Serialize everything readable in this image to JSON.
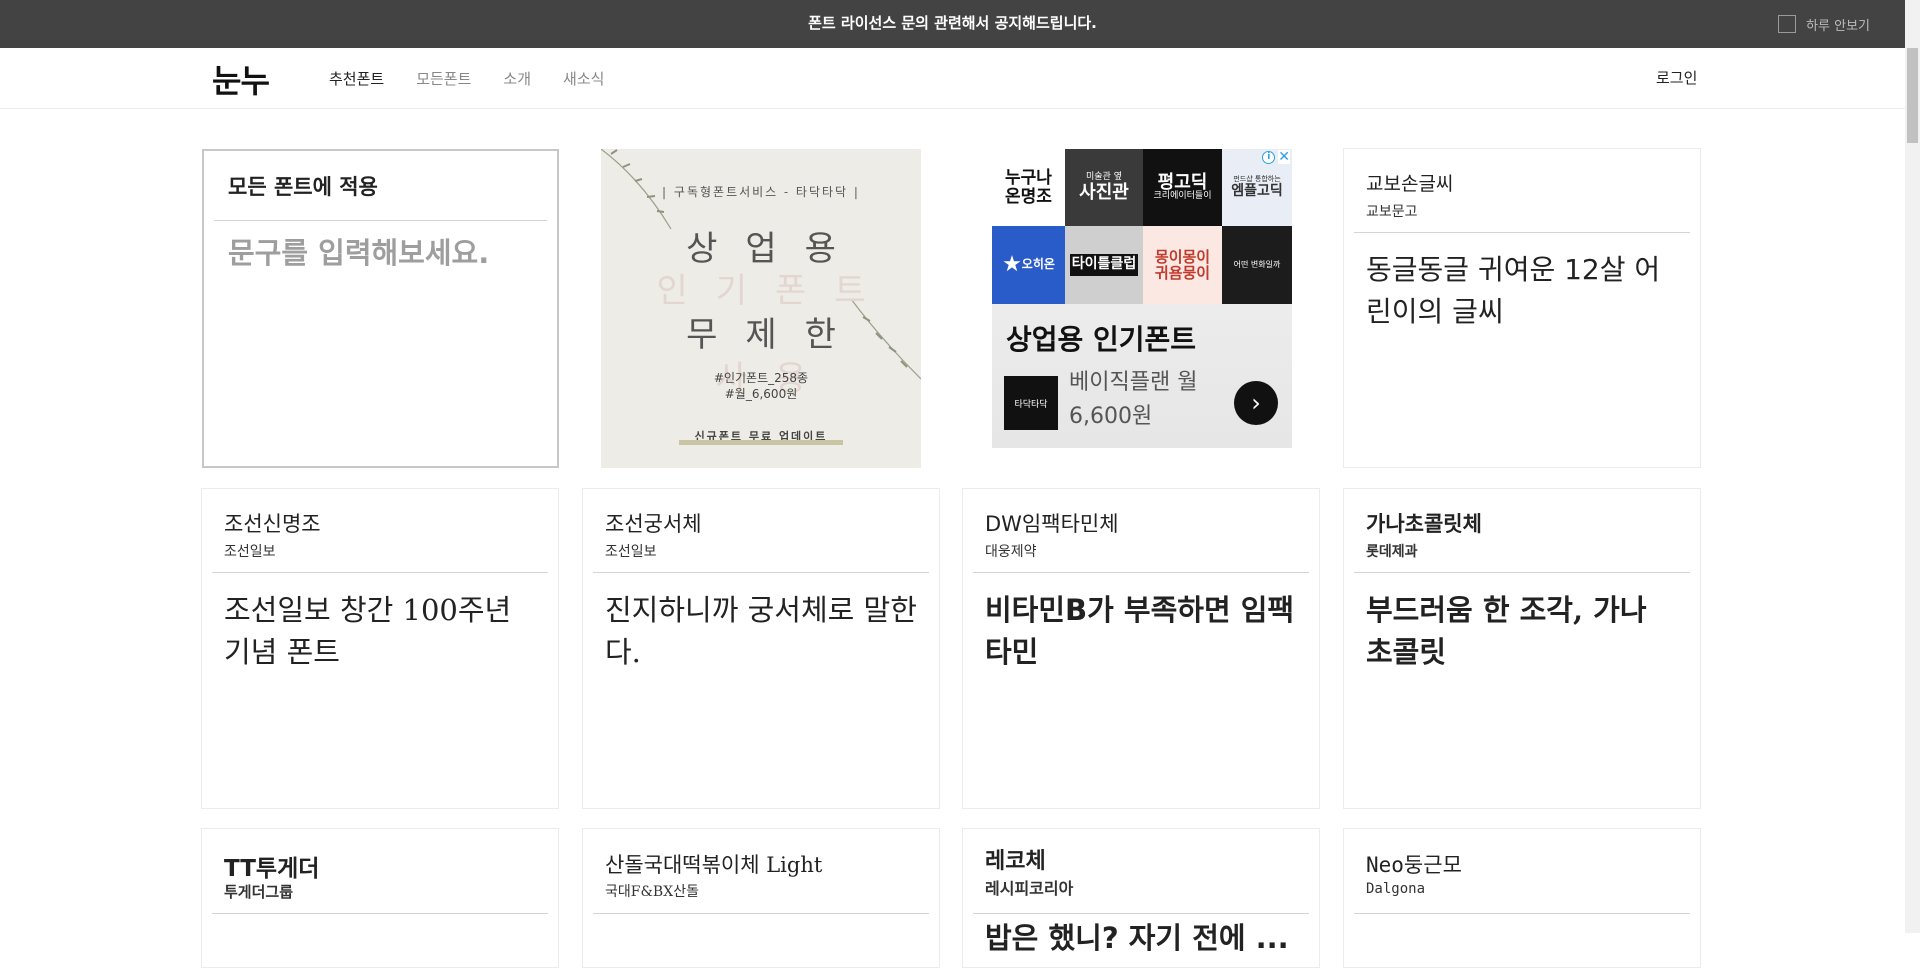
{
  "notice": {
    "text": "폰트 라이선스 문의 관련해서 공지해드립니다.",
    "hide_label": "하루 안보기"
  },
  "header": {
    "logo": "눈누",
    "nav": [
      {
        "label": "추천폰트",
        "active": true
      },
      {
        "label": "모든폰트",
        "active": false
      },
      {
        "label": "소개",
        "active": false
      },
      {
        "label": "새소식",
        "active": false
      }
    ],
    "login": "로그인"
  },
  "apply_card": {
    "title": "모든 폰트에 적용",
    "placeholder": "문구를 입력해보세요."
  },
  "ad1": {
    "subtitle": "| 구독형폰트서비스 - 타닥타닥 |",
    "line1": "상업용",
    "line2": "인기폰트",
    "line3": "무제한",
    "line4": "사용",
    "info1": "#인기폰트_258종",
    "info2": "#월_6,600원",
    "footer": "신규폰트 무료 업데이트"
  },
  "ad2": {
    "tiles": [
      {
        "text": "누구나\n온명조",
        "bg": "#ffffff",
        "color": "#111111"
      },
      {
        "text": "사진관",
        "small": "미술관 옆",
        "bg": "#3a3a3a",
        "color": "#ffffff"
      },
      {
        "text": "평고딕",
        "small": "크리에이터들이",
        "bg": "#111111",
        "color": "#ffffff"
      },
      {
        "text": "엠플고딕",
        "small": "펀드샵 통합하는",
        "bg": "#e9edf5",
        "color": "#333333"
      },
      {
        "text": "오히온",
        "bg": "#2a5cc9",
        "color": "#ffffff"
      },
      {
        "text": "타이틀클럽",
        "bg": "#cfcfcf",
        "color": "#111111"
      },
      {
        "text": "몽이몽이\n귀욤뭉이",
        "bg": "#fbe8e3",
        "color": "#c0392b"
      },
      {
        "text": "어떤 변화일까",
        "bg": "#1c1c1c",
        "color": "#ffffff"
      }
    ],
    "headline": "상업용 인기폰트",
    "logo_text": "타닥타닥",
    "plan_line1": "베이직플랜 월",
    "plan_line2": "6,600원",
    "go_arrow": "›",
    "adchoices_symbol": "i",
    "close_symbol": "✕"
  },
  "cards": [
    {
      "name": "교보손글씨",
      "maker": "교보문고",
      "sample": "동글동글 귀여운 12살 어린이의 글씨"
    },
    {
      "name": "조선신명조",
      "maker": "조선일보",
      "sample": "조선일보 창간 100주년 기념 폰트"
    },
    {
      "name": "조선궁서체",
      "maker": "조선일보",
      "sample": "진지하니까 궁서체로 말한다."
    },
    {
      "name": "DW임팩타민체",
      "maker": "대웅제약",
      "sample": "비타민B가 부족하면 임팩타민"
    },
    {
      "name": "가나초콜릿체",
      "maker": "롯데제과",
      "sample": "부드러움 한 조각, 가나 초콜릿"
    },
    {
      "name": "TT투게더",
      "maker": "투게더그룹",
      "sample": ""
    },
    {
      "name": "산돌국대떡볶이체 Light",
      "maker": "국대F&BX산돌",
      "sample": ""
    },
    {
      "name": "레코체",
      "maker": "레시피코리아",
      "sample": "밥은 했니? 자기 전에 ..."
    },
    {
      "name": "Neo둥근모",
      "maker": "Dalgona",
      "sample": ""
    }
  ]
}
